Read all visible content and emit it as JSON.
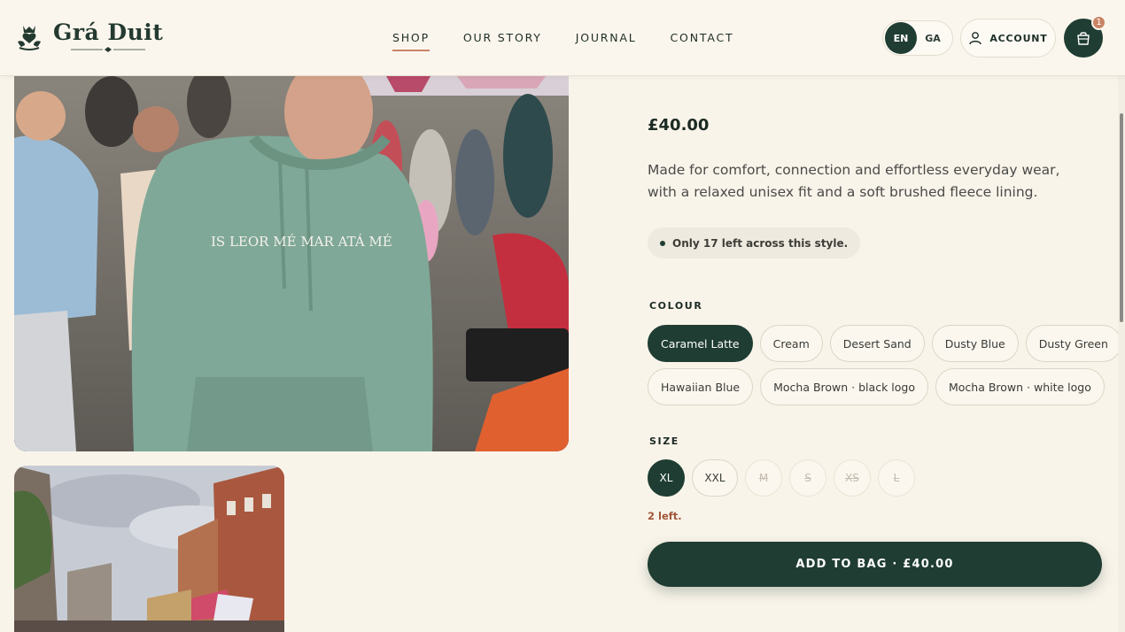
{
  "brand": {
    "name": "Grá Duit"
  },
  "nav": {
    "items": [
      "SHOP",
      "OUR STORY",
      "JOURNAL",
      "CONTACT"
    ],
    "active": "SHOP"
  },
  "lang": {
    "en": "EN",
    "ga": "GA",
    "active": "EN"
  },
  "account": {
    "label": "ACCOUNT"
  },
  "bag": {
    "count": "1"
  },
  "gallery": {
    "hoodie_text": "IS LEOR MÉ MAR ATÁ MÉ"
  },
  "product": {
    "price": "£40.00",
    "description": "Made for comfort, connection and effortless everyday wear, with a relaxed unisex fit and a soft brushed fleece lining.",
    "stock_note": "Only 17 left across this style.",
    "colour_label": "COLOUR",
    "colours": [
      "Caramel Latte",
      "Cream",
      "Desert Sand",
      "Dusty Blue",
      "Dusty Green",
      "Hawaiian Blue",
      "Mocha Brown · black logo",
      "Mocha Brown · white logo"
    ],
    "selected_colour": "Caramel Latte",
    "size_label": "SIZE",
    "sizes": [
      "XL",
      "XXL",
      "M",
      "S",
      "XS",
      "L"
    ],
    "selected_size": "XL",
    "unavailable_sizes": [
      "M",
      "S",
      "XS",
      "L"
    ],
    "size_left": "2 left.",
    "add_to_bag": "ADD TO BAG · £40.00"
  },
  "colors": {
    "accent": "#1f3d33",
    "highlight": "#c98365",
    "background": "#f9f4ea"
  }
}
